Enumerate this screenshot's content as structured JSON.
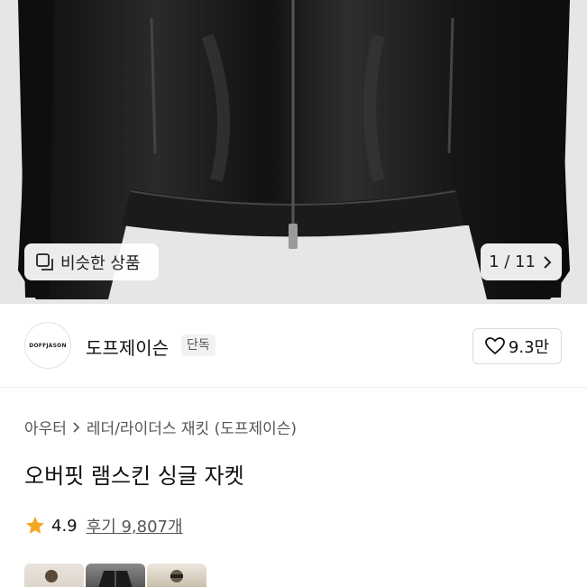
{
  "gallery": {
    "similar_label": "비슷한 상품",
    "similar_icon": "similar-items-icon",
    "pager_current": "1",
    "pager_total": "11",
    "pager_text": "1 / 11"
  },
  "brand": {
    "logo_text": "DOFFJASON",
    "name": "도프제이슨",
    "tag": "단독",
    "likes": "9.3만"
  },
  "breadcrumb": {
    "level1": "아우터",
    "level2": "레더/라이더스 재킷 (도프제이슨)"
  },
  "product": {
    "title": "오버핏 램스킨 싱글 자켓"
  },
  "rating": {
    "score": "4.9",
    "reviews": "후기 9,807개"
  },
  "colors": {
    "accent_star": "#f5a623",
    "hero_bg": "#e6e6e8"
  }
}
